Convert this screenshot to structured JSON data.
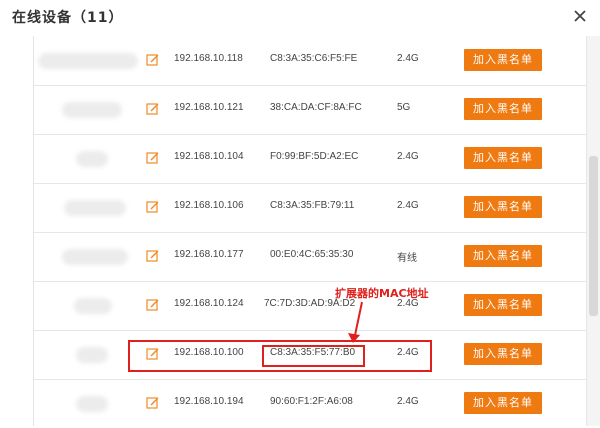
{
  "dialog": {
    "title": "在线设备（11）",
    "close_icon": "close-icon"
  },
  "devices": [
    {
      "ip": "192.168.10.118",
      "mac": "C8:3A:35:C6:F5:FE",
      "band": "2.4G",
      "button": "加入黑名单"
    },
    {
      "ip": "192.168.10.121",
      "mac": "38:CA:DA:CF:8A:FC",
      "band": "5G",
      "button": "加入黑名单"
    },
    {
      "ip": "192.168.10.104",
      "mac": "F0:99:BF:5D:A2:EC",
      "band": "2.4G",
      "button": "加入黑名单"
    },
    {
      "ip": "192.168.10.106",
      "mac": "C8:3A:35:FB:79:11",
      "band": "2.4G",
      "button": "加入黑名单"
    },
    {
      "ip": "192.168.10.177",
      "mac": "00:E0:4C:65:35:30",
      "band": "有线",
      "button": "加入黑名单"
    },
    {
      "ip": "192.168.10.124",
      "mac": "7C:7D:3D:AD:9A:D2",
      "band": "2.4G",
      "button": "加入黑名单"
    },
    {
      "ip": "192.168.10.100",
      "mac": "C8:3A:35:F5:77:B0",
      "band": "2.4G",
      "button": "加入黑名单"
    },
    {
      "ip": "192.168.10.194",
      "mac": "90:60:F1:2F:A6:08",
      "band": "2.4G",
      "button": "加入黑名单"
    }
  ],
  "annotation": {
    "text": "扩展器的MAC地址",
    "color": "#e0201c"
  },
  "colors": {
    "button": "#f07a12",
    "edit_icon": "#f08a24",
    "highlight": "#e0201c"
  }
}
